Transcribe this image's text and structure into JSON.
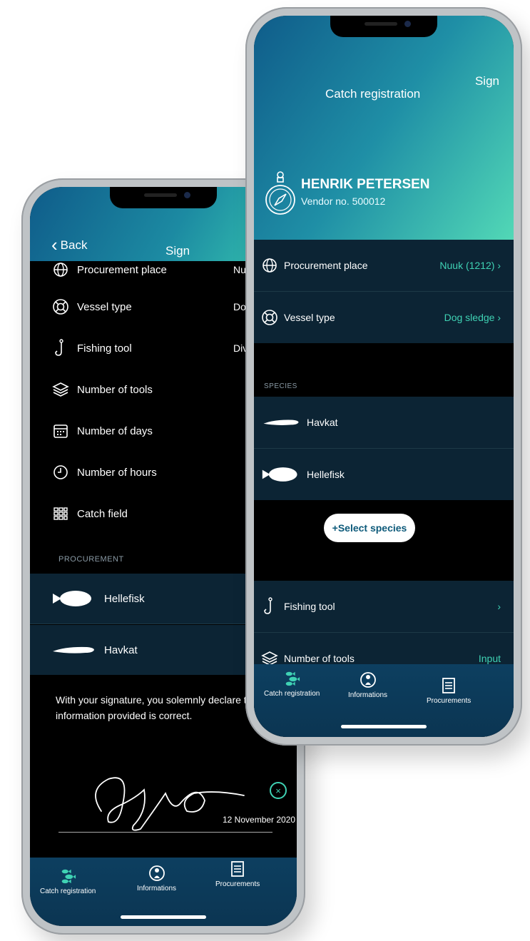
{
  "left_phone": {
    "header": {
      "back_label": "Back",
      "title": "Sign"
    },
    "rows": [
      {
        "label": "Procurement place",
        "value": "Nu",
        "icon": "globe-icon"
      },
      {
        "label": "Vessel type",
        "value": "Do",
        "icon": "lifebuoy-icon"
      },
      {
        "label": "Fishing tool",
        "value": "Divers",
        "icon": "hook-icon"
      },
      {
        "label": "Number of tools",
        "value": "",
        "icon": "layers-icon"
      },
      {
        "label": "Number of days",
        "value": "",
        "icon": "calendar-icon"
      },
      {
        "label": "Number of hours",
        "value": "",
        "icon": "clock-icon"
      },
      {
        "label": "Catch field",
        "value": "",
        "icon": "grid-icon"
      }
    ],
    "procurement_label": "PROCUREMENT",
    "procurement_items": [
      {
        "name": "Hellefisk"
      },
      {
        "name": "Havkat"
      }
    ],
    "declaration": "With your signature, you solemnly declare that information provided is correct.",
    "signature_date": "12 November 2020",
    "tabs": [
      {
        "label": "Catch registration",
        "icon": "fish-icon"
      },
      {
        "label": "Informations",
        "icon": "info-icon"
      },
      {
        "label": "Procurements",
        "icon": "document-icon"
      }
    ]
  },
  "right_phone": {
    "header": {
      "title": "Catch registration",
      "sign_label": "Sign"
    },
    "vendor": {
      "name": "HENRIK PETERSEN",
      "number": "Vendor no. 500012"
    },
    "rows": [
      {
        "label": "Procurement place",
        "value": "Nuuk (1212)",
        "icon": "globe-icon"
      },
      {
        "label": "Vessel type",
        "value": "Dog sledge",
        "icon": "lifebuoy-icon"
      }
    ],
    "species_label": "SPECIES",
    "species": [
      {
        "name": "Havkat"
      },
      {
        "name": "Hellefisk"
      }
    ],
    "select_species_label": "+Select species",
    "rows_bottom": [
      {
        "label": "Fishing tool",
        "value": "",
        "icon": "hook-icon"
      },
      {
        "label": "Number of tools",
        "value": "Input",
        "icon": "layers-icon"
      }
    ],
    "tabs": [
      {
        "label": "Catch registration",
        "icon": "fish-icon"
      },
      {
        "label": "Informations",
        "icon": "info-icon"
      },
      {
        "label": "Procurements",
        "icon": "document-icon"
      }
    ]
  },
  "colors": {
    "accent": "#3fd2b4",
    "header_start": "#0f5c8a",
    "header_end": "#52d8b6",
    "row_bg": "#0c2434",
    "tabbar": "#0d3f60"
  }
}
